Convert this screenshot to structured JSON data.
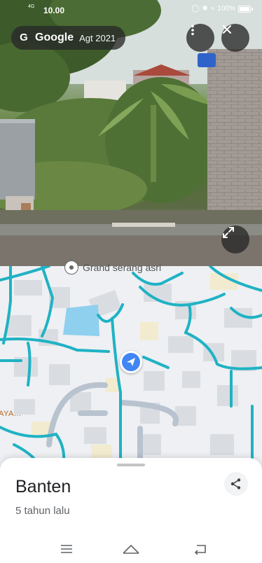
{
  "status_bar": {
    "network": "4G",
    "time": "10.00",
    "battery": "100%"
  },
  "street_view": {
    "brand": "Google",
    "date": "Agt 2021",
    "buttons": {
      "more": "more-vert-icon",
      "close": "close-icon",
      "expand": "expand-icon"
    }
  },
  "map": {
    "poi_label": "Grand serang asri",
    "area_label": "AYA...",
    "colors": {
      "road": "#1fb2c4",
      "building": "#d9dde2",
      "water": "#8fd0ee",
      "user": "#4285f4"
    }
  },
  "place": {
    "title": "Banten",
    "subtitle": "5 tahun lalu",
    "share_icon": "share-icon"
  },
  "nav_bar": {
    "menu_icon": "menu-icon",
    "home_icon": "home-icon",
    "back_icon": "back-icon"
  }
}
